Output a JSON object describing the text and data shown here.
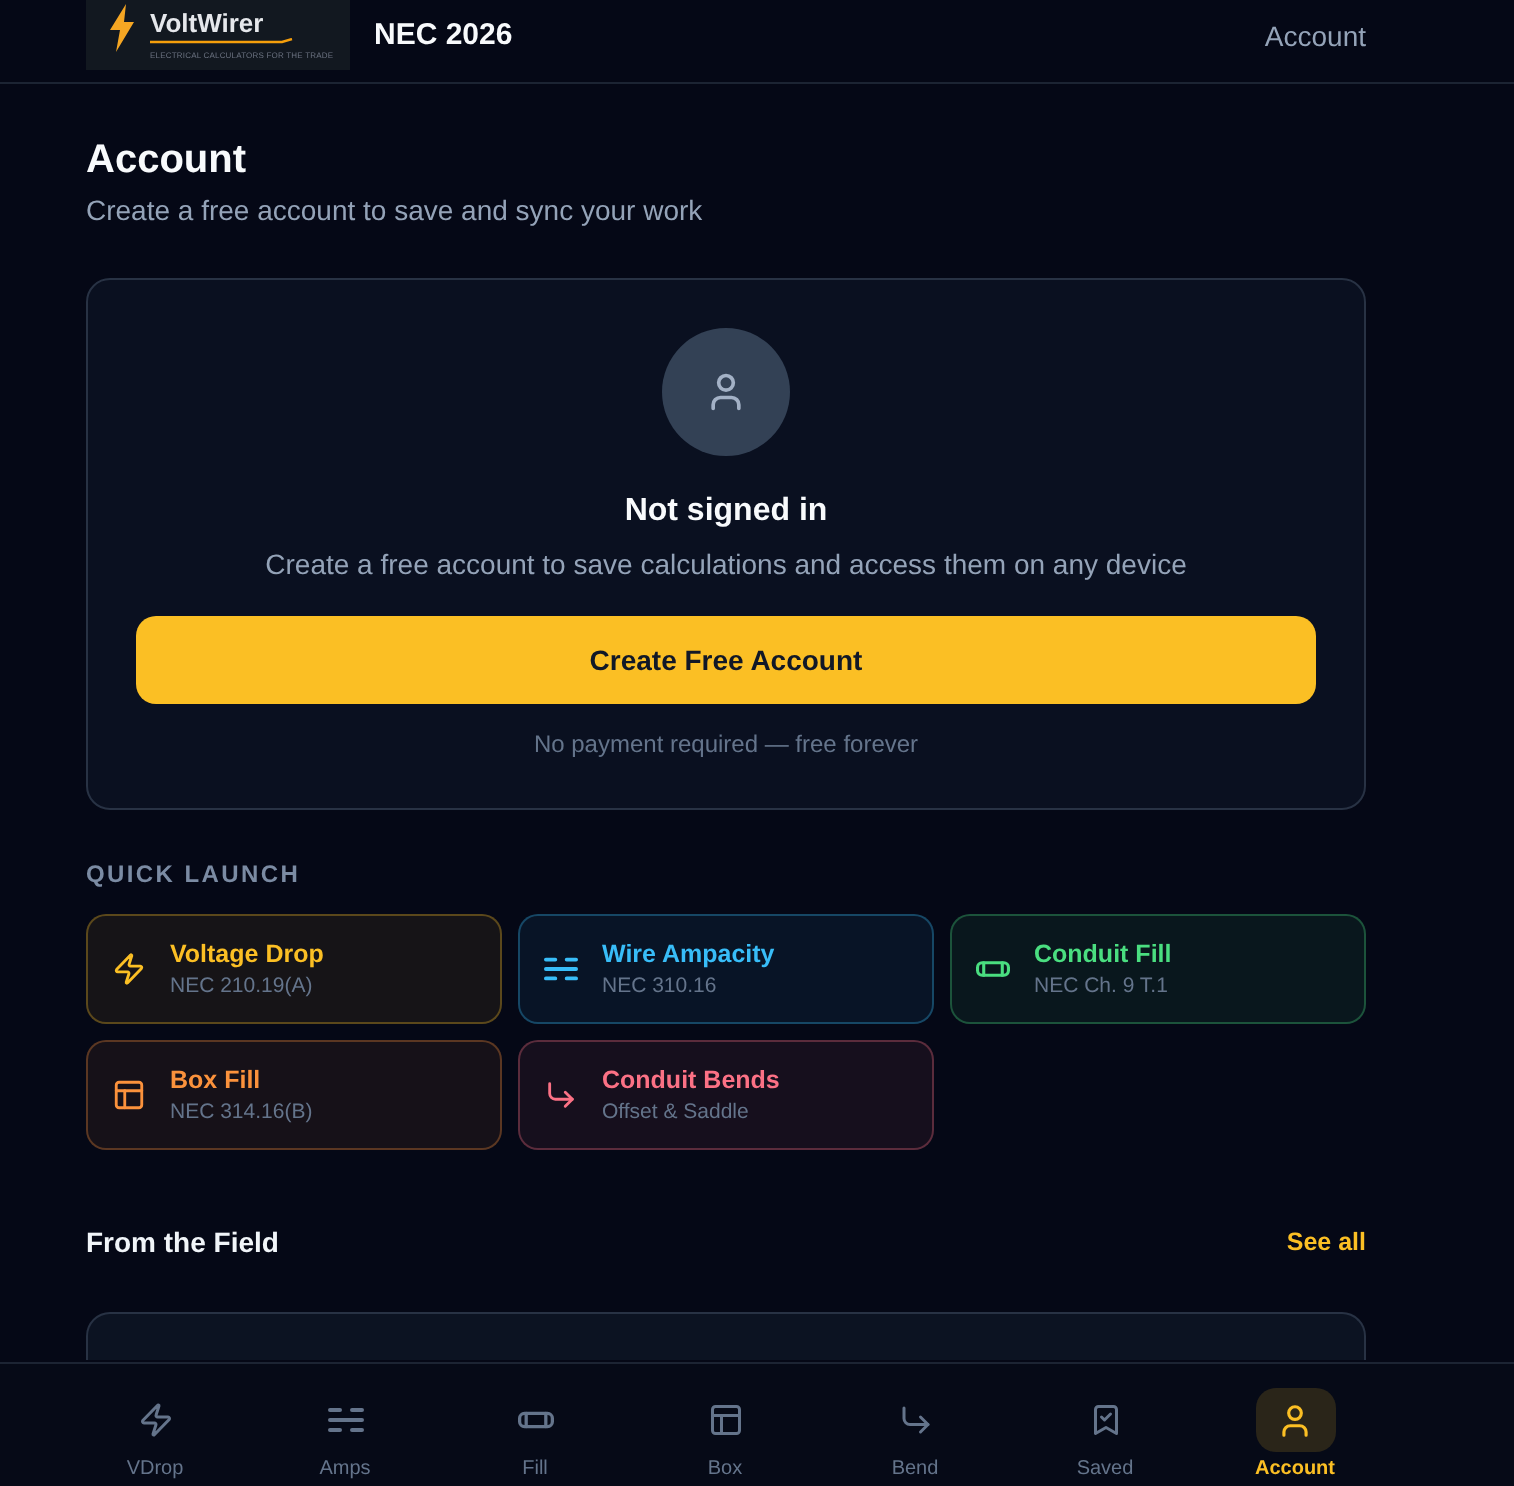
{
  "header": {
    "logo": {
      "name": "VoltWirer",
      "tagline": "ELECTRICAL CALCULATORS FOR THE TRADE"
    },
    "edition": "NEC 2026",
    "account_link": "Account"
  },
  "page": {
    "title": "Account",
    "subtitle": "Create a free account to save and sync your work"
  },
  "auth_card": {
    "status": "Not signed in",
    "message": "Create a free account to save calculations and access them on any device",
    "button": "Create Free Account",
    "note": "No payment required — free forever"
  },
  "quick_launch": {
    "heading": "QUICK LAUNCH",
    "items": [
      {
        "kind": "voltage-drop",
        "title": "Voltage Drop",
        "subtitle": "NEC 210.19(A)",
        "color": "#fbbf24"
      },
      {
        "kind": "ampacity",
        "title": "Wire Ampacity",
        "subtitle": "NEC 310.16",
        "color": "#38bdf8"
      },
      {
        "kind": "conduit-fill",
        "title": "Conduit Fill",
        "subtitle": "NEC Ch. 9 T.1",
        "color": "#4ade80"
      },
      {
        "kind": "box-fill",
        "title": "Box Fill",
        "subtitle": "NEC 314.16(B)",
        "color": "#fb923c"
      },
      {
        "kind": "bends",
        "title": "Conduit Bends",
        "subtitle": "Offset & Saddle",
        "color": "#fb7185"
      }
    ]
  },
  "reviews": {
    "heading": "From the Field",
    "link": "See all"
  },
  "bottom_nav": [
    {
      "kind": "voltage-drop",
      "label": "VDrop",
      "selected": false
    },
    {
      "kind": "ampacity",
      "label": "Amps",
      "selected": false
    },
    {
      "kind": "conduit-fill",
      "label": "Fill",
      "selected": false
    },
    {
      "kind": "box-fill",
      "label": "Box",
      "selected": false
    },
    {
      "kind": "bends",
      "label": "Bend",
      "selected": false
    },
    {
      "kind": "saved",
      "label": "Saved",
      "selected": false
    },
    {
      "kind": "account",
      "label": "Account",
      "selected": true
    }
  ]
}
